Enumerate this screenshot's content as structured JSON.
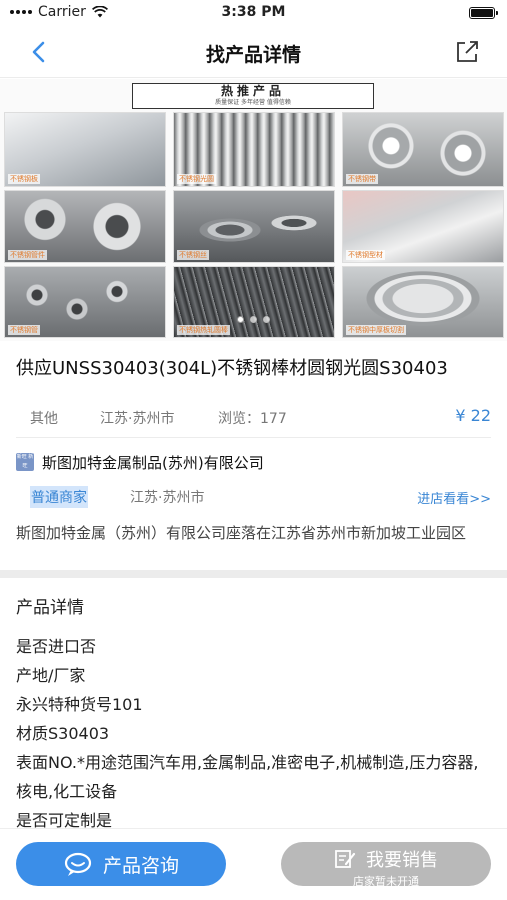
{
  "status": {
    "carrier": "Carrier",
    "time": "3:38 PM"
  },
  "nav": {
    "title": "找产品详情"
  },
  "banner": {
    "header": "热推产品",
    "subheader": "质量保证    多年经营    值得信赖",
    "tiles": [
      "不锈钢板",
      "不锈钢光圆",
      "不锈钢带",
      "不锈钢管件",
      "不锈钢丝",
      "不锈钢型材",
      "不锈钢管",
      "不锈钢热轧圆棒",
      "不锈钢中厚板切割"
    ],
    "slide_count": 3,
    "active_slide": 1
  },
  "product": {
    "title": "供应UNSS30403(304L)不锈钢棒材圆钢光圆S30403",
    "category": "其他",
    "location": "江苏·苏州市",
    "views": "浏览：177",
    "price": "¥ 22"
  },
  "company": {
    "icon_text": "新旺 新旺",
    "name": "斯图加特金属制品(苏州)有限公司",
    "merchant_type": "普通商家",
    "location": "江苏·苏州市",
    "store_link": "进店看看>>",
    "description": "斯图加特金属（苏州）有限公司座落在江苏省苏州市新加坡工业园区"
  },
  "details": {
    "title": "产品详情",
    "lines": [
      "是否进口否",
      "产地/厂家",
      "永兴特种货号101",
      "材质S30403",
      "表面NO.*用途范围汽车用,金属制品,准密电子,机械制造,压力容器,核电,化工设备",
      "是否可定制是"
    ]
  },
  "bottom": {
    "consult_label": "产品咨询",
    "sell_label": "我要销售",
    "sell_sublabel": "店家暂未开通"
  },
  "colors": {
    "accent": "#3b8ee8",
    "disabled": "#b9b9b9",
    "price": "#3a86d4"
  }
}
